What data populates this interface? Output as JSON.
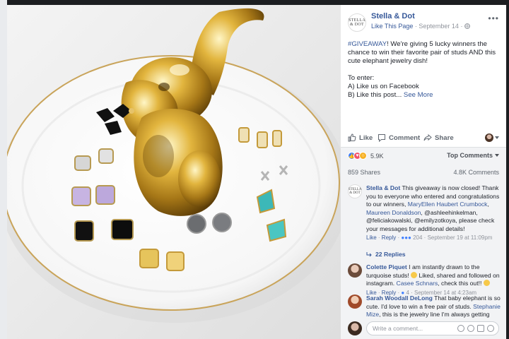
{
  "post": {
    "page_name": "Stella & Dot",
    "logo_text": "STELLA & DOT",
    "like_page": "Like This Page",
    "date": "September 14",
    "hashtag": "#GIVEAWAY",
    "text_rest": "! We're giving 5 lucky winners the chance to win their favorite pair of studs AND this cute elephant jewelry dish!",
    "to_enter": "To enter:",
    "step_a": "A) Like us on Facebook",
    "step_b": "B) Like this post...",
    "see_more": "See More"
  },
  "actions": {
    "like": "Like",
    "comment": "Comment",
    "share": "Share"
  },
  "stats": {
    "reactions": "5.9K",
    "top_comments": "Top Comments",
    "shares": "859 Shares",
    "comments": "4.8K Comments"
  },
  "comments": [
    {
      "name": "Stella & Dot",
      "text1": " This giveaway is now closed! Thank you to everyone who entered and congratulations to our winners, ",
      "m1": "MaryEllen Haubert Crumbock",
      "s1": ", ",
      "m2": "Maureen Donaldson",
      "text2": ", @ashleehinkelman, @feliciakowalski, @emilyzotkoya, please check your messages for additional details!",
      "like": "Like",
      "reply": "Reply",
      "count": "204",
      "date": "September 19 at 11:09pm"
    },
    {
      "name": "Colette Piquet",
      "text1": " I am instantly drawn to the turquoise studs! ",
      "text2": " Liked, shared and followed on instagram. ",
      "m1": "Casee Schnars",
      "text3": ", check this out!! ",
      "like": "Like",
      "reply": "Reply",
      "count": "4",
      "date": "September 14 at 4:23am"
    },
    {
      "name": "Sarah Woodall DeLong",
      "text1": " That baby elephant is so cute. I'd love to win a free pair of studs. ",
      "m1": "Stephanie Mize",
      "text2": ", this is the jewelry line I'm always getting"
    }
  ],
  "replies_label": "22 Replies",
  "composer_placeholder": "Write a comment...",
  "colors": {
    "link": "#365899",
    "accent": "#4080ff"
  }
}
